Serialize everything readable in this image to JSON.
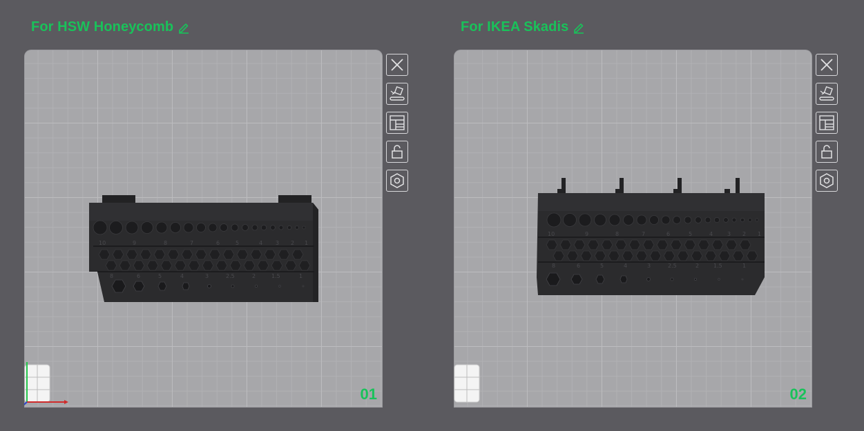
{
  "plates": [
    {
      "title": "For HSW Honeycomb",
      "number": "01",
      "model_labels_top": [
        "10",
        "9",
        "8",
        "7",
        "6",
        "5",
        "4",
        "3",
        "2",
        "1"
      ],
      "model_labels_bottom": [
        "8",
        "6",
        "5",
        "4",
        "3",
        "2.5",
        "2",
        "1.5",
        "1"
      ]
    },
    {
      "title": "For IKEA Skadis",
      "number": "02",
      "model_labels_top": [
        "10",
        "9",
        "8",
        "7",
        "6",
        "5",
        "4",
        "3",
        "2",
        "1"
      ],
      "model_labels_bottom": [
        "8",
        "6",
        "5",
        "4",
        "3",
        "2.5",
        "2",
        "1.5",
        "1"
      ]
    }
  ],
  "tools": [
    {
      "name": "close-plate",
      "icon": "close-icon"
    },
    {
      "name": "auto-orient",
      "icon": "auto-orient-icon"
    },
    {
      "name": "arrange",
      "icon": "arrange-icon"
    },
    {
      "name": "lock-plate",
      "icon": "lock-icon"
    },
    {
      "name": "plate-settings",
      "icon": "hex-settings-icon"
    }
  ],
  "colors": {
    "accent": "#19c25a",
    "background": "#5b5a5f",
    "plate": "#a7a7aa",
    "model": "#2b2b2d"
  }
}
